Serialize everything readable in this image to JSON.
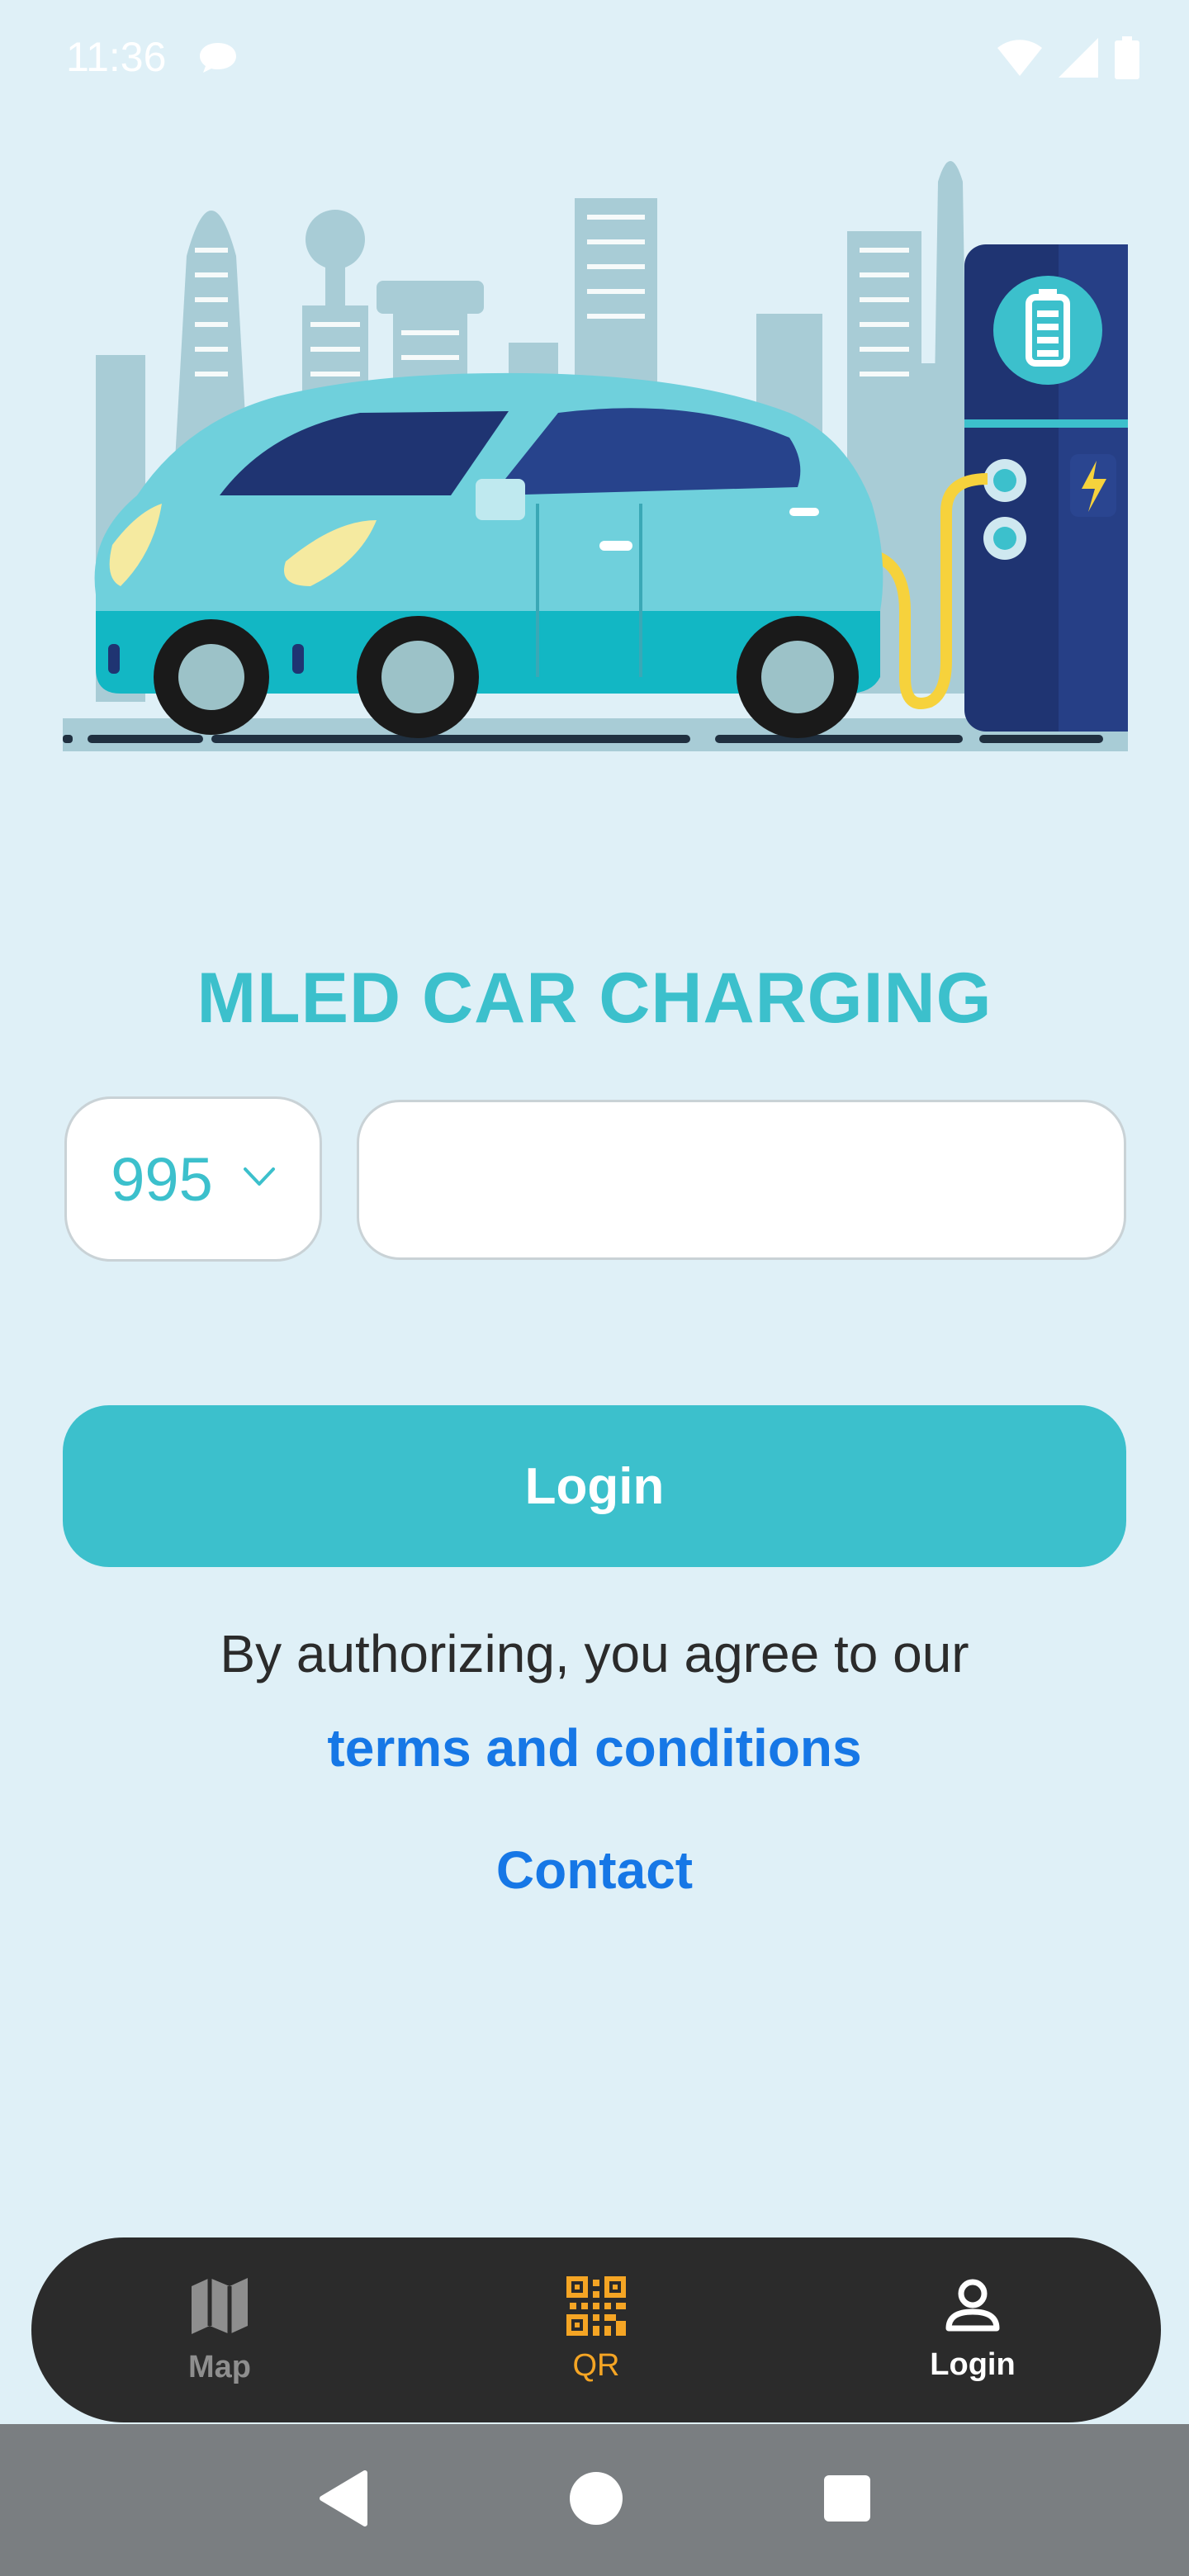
{
  "status_bar": {
    "time": "11:36"
  },
  "app": {
    "title": "MLED CAR CHARGING"
  },
  "phone": {
    "country_code": "995",
    "placeholder": ""
  },
  "login_button": "Login",
  "legal": {
    "agree_text": "By authorizing, you agree to our",
    "terms_link": "terms and conditions"
  },
  "contact_link": "Contact",
  "bottom_nav": {
    "map": "Map",
    "qr": "QR",
    "login": "Login"
  },
  "colors": {
    "accent": "#3cc0cc",
    "link": "#1677e6",
    "qr_active": "#f5a524",
    "nav_bg": "#2b2b2b"
  },
  "icons": [
    "chat-bubble-icon",
    "wifi-icon",
    "signal-icon",
    "battery-icon",
    "chevron-down-icon",
    "map-icon",
    "qr-code-icon",
    "person-icon",
    "back-icon",
    "home-icon",
    "recents-icon"
  ]
}
